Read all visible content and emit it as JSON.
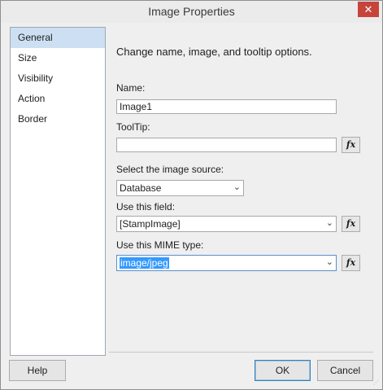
{
  "window": {
    "title": "Image Properties",
    "close_label": "✕"
  },
  "sidebar": {
    "items": [
      {
        "label": "General"
      },
      {
        "label": "Size"
      },
      {
        "label": "Visibility"
      },
      {
        "label": "Action"
      },
      {
        "label": "Border"
      }
    ],
    "selected": "General"
  },
  "main": {
    "heading": "Change name, image, and tooltip options.",
    "name": {
      "label": "Name:",
      "value": "Image1"
    },
    "tooltip": {
      "label": "ToolTip:",
      "value": ""
    },
    "image_source": {
      "label": "Select the image source:",
      "value": "Database"
    },
    "field": {
      "label": "Use this field:",
      "value": "[StampImage]"
    },
    "mime": {
      "label": "Use this MIME type:",
      "value": "image/jpeg"
    },
    "fx_label": "fx"
  },
  "footer": {
    "help": "Help",
    "ok": "OK",
    "cancel": "Cancel"
  }
}
